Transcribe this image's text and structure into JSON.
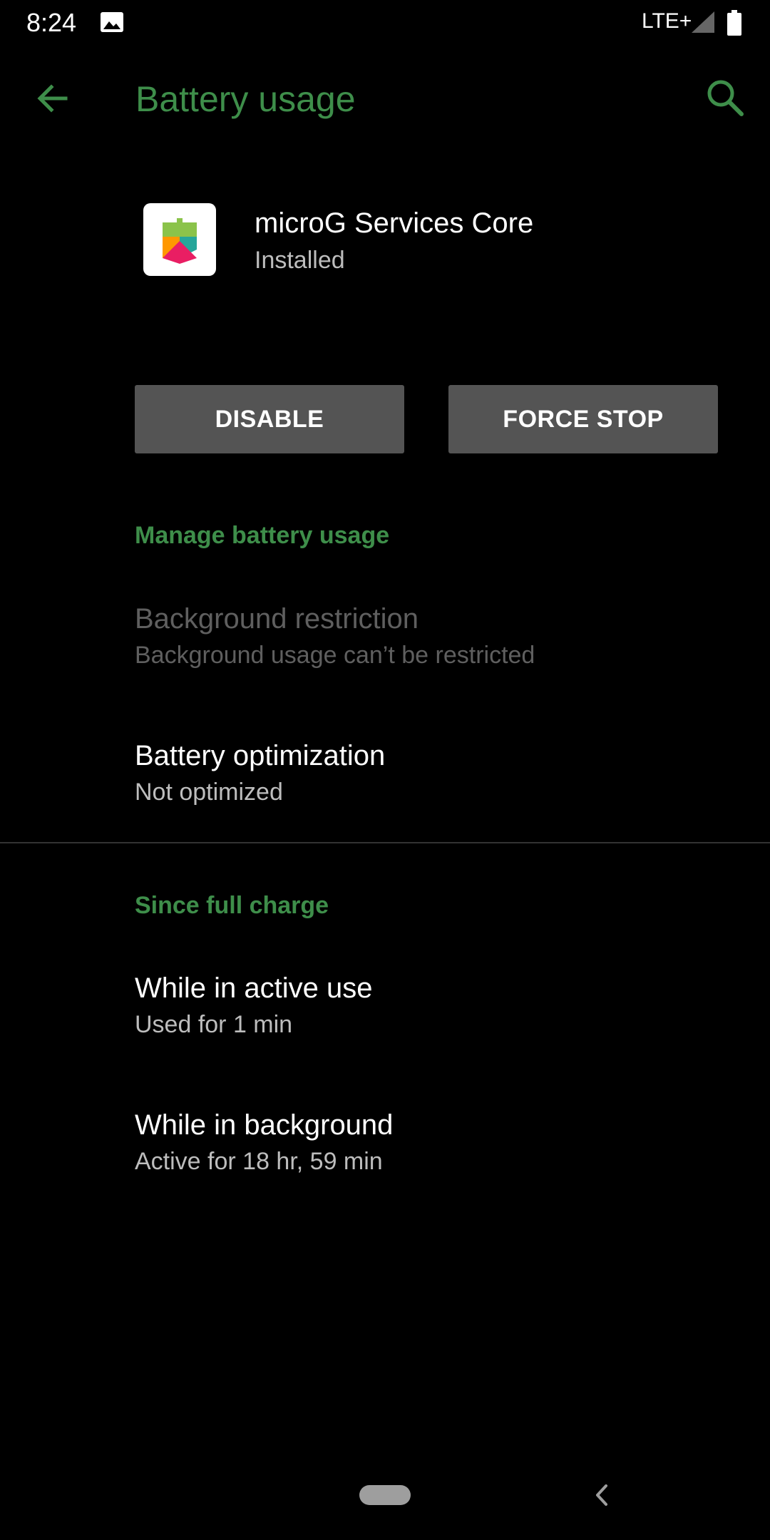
{
  "status_bar": {
    "time": "8:24",
    "network": "LTE+"
  },
  "app_bar": {
    "title": "Battery usage",
    "accent_color": "#3e8e4a"
  },
  "app": {
    "name": "microG Services Core",
    "status": "Installed"
  },
  "buttons": {
    "disable": "DISABLE",
    "force_stop": "FORCE STOP"
  },
  "manage": {
    "header": "Manage battery usage",
    "background_restriction": {
      "title": "Background restriction",
      "summary": "Background usage can’t be restricted"
    },
    "battery_optimization": {
      "title": "Battery optimization",
      "summary": "Not optimized"
    }
  },
  "since_full_charge": {
    "header": "Since full charge",
    "active_use": {
      "title": "While in active use",
      "summary": "Used for 1 min"
    },
    "background": {
      "title": "While in background",
      "summary": "Active for 18 hr, 59 min"
    }
  }
}
